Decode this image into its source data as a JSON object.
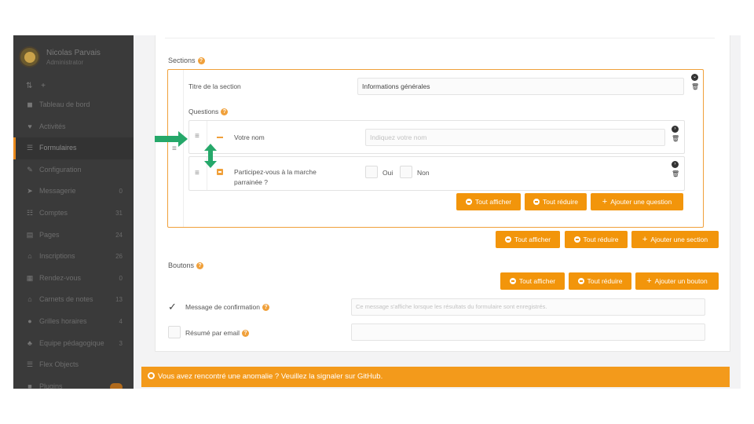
{
  "user": {
    "name": "Nicolas Parvais",
    "role": "Administrator"
  },
  "sidebar": {
    "toolbar": [
      "⇅",
      "+"
    ],
    "items": [
      {
        "icon": "dashboard-icon",
        "glyph": "◼",
        "label": "Tableau de bord",
        "count": ""
      },
      {
        "icon": "heart-icon",
        "glyph": "♥",
        "label": "Activités",
        "count": ""
      },
      {
        "icon": "list-icon",
        "glyph": "☰",
        "label": "Formulaires",
        "count": "",
        "active": true
      },
      {
        "icon": "wrench-icon",
        "glyph": "✎",
        "label": "Configuration",
        "count": ""
      },
      {
        "icon": "send-icon",
        "glyph": "➤",
        "label": "Messagerie",
        "count": "0"
      },
      {
        "icon": "users-icon",
        "glyph": "☷",
        "label": "Comptes",
        "count": "31"
      },
      {
        "icon": "file-icon",
        "glyph": "▤",
        "label": "Pages",
        "count": "24"
      },
      {
        "icon": "bank-icon",
        "glyph": "⌂",
        "label": "Inscriptions",
        "count": "26"
      },
      {
        "icon": "calendar-icon",
        "glyph": "▦",
        "label": "Rendez-vous",
        "count": "0"
      },
      {
        "icon": "bank-icon",
        "glyph": "⌂",
        "label": "Carnets de notes",
        "count": "13"
      },
      {
        "icon": "clock-icon",
        "glyph": "●",
        "label": "Grilles horaires",
        "count": "4"
      },
      {
        "icon": "team-icon",
        "glyph": "♣",
        "label": "Equipe pédagogique",
        "count": "3"
      },
      {
        "icon": "flex-icon",
        "glyph": "☰",
        "label": "Flex Objects",
        "count": ""
      },
      {
        "icon": "plugin-icon",
        "glyph": "■",
        "label": "Plugins",
        "count": "",
        "badge": true
      }
    ]
  },
  "main": {
    "sections_label": "Sections",
    "section": {
      "title_label": "Titre de la section",
      "title_value": "Informations générales",
      "questions_label": "Questions",
      "questions": [
        {
          "label": "Votre nom",
          "placeholder": "Indiquez votre nom"
        },
        {
          "label": "Participez-vous à la marche parrainée ?",
          "options": [
            "Oui",
            "Non"
          ]
        }
      ],
      "buttons": {
        "show_all": "Tout afficher",
        "collapse_all": "Tout réduire",
        "add": "Ajouter une question"
      }
    },
    "sections_buttons": {
      "show_all": "Tout afficher",
      "collapse_all": "Tout réduire",
      "add": "Ajouter une section"
    },
    "buttons_label": "Boutons",
    "buttons_buttons": {
      "show_all": "Tout afficher",
      "collapse_all": "Tout réduire",
      "add": "Ajouter un bouton"
    },
    "confirmation": {
      "label": "Message de confirmation",
      "placeholder": "Ce message s'affiche lorsque les résultats du formulaire sont enregistrés.",
      "checked": true
    },
    "summary": {
      "label": "Résumé par email",
      "checked": false
    }
  },
  "banner": {
    "text": "Vous avez rencontré une anomalie ? Veuillez la signaler sur GitHub."
  },
  "colors": {
    "accent": "#f2950b",
    "sidebar": "#3a3a3a",
    "green_arrow": "#26a86a"
  }
}
